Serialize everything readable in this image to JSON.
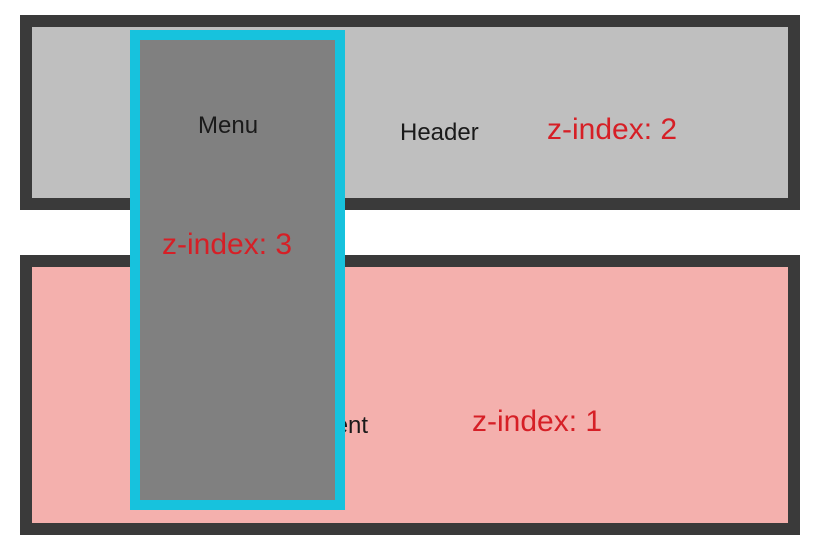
{
  "content": {
    "label": "Content",
    "z_index_label": "z-index: 1",
    "z_index": 1,
    "fill": "#f4b0ad",
    "border": "#3a3a3a"
  },
  "header": {
    "label": "Header",
    "z_index_label": "z-index: 2",
    "z_index": 2,
    "fill": "#bfbfbf",
    "border": "#3a3a3a"
  },
  "menu": {
    "label": "Menu",
    "z_index_label": "z-index: 3",
    "z_index": 3,
    "fill": "#808080",
    "border": "#17c2dd"
  },
  "colors": {
    "text": "#1a1a1a",
    "accent": "#d61f26"
  }
}
